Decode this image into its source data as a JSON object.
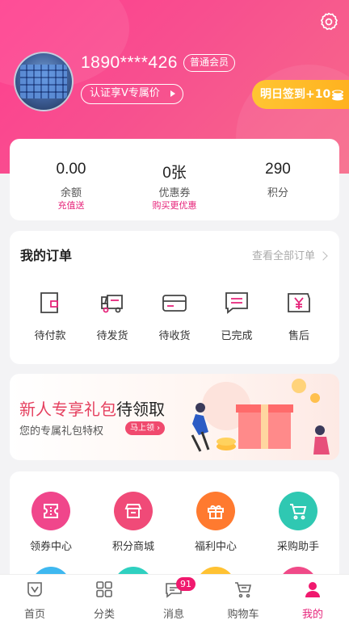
{
  "profile": {
    "phone": "1890****426",
    "member_level": "普通会员",
    "verify_label": "认证享V专属价",
    "sign_in_label": "明日签到+10"
  },
  "stats": [
    {
      "value": "0.00",
      "label": "余额",
      "action": "充值送"
    },
    {
      "value": "0张",
      "label": "优惠券",
      "action": "购买更优惠"
    },
    {
      "value": "290",
      "label": "积分",
      "action": ""
    }
  ],
  "orders": {
    "title": "我的订单",
    "view_all": "查看全部订单",
    "items": [
      {
        "label": "待付款",
        "icon": "wallet-icon"
      },
      {
        "label": "待发货",
        "icon": "delivery-truck-icon"
      },
      {
        "label": "待收货",
        "icon": "card-box-icon"
      },
      {
        "label": "已完成",
        "icon": "message-done-icon"
      },
      {
        "label": "售后",
        "icon": "yen-ticket-icon"
      }
    ]
  },
  "banner": {
    "title_highlight": "新人专享礼包",
    "title_rest": "待领取",
    "subtitle": "您的专属礼包特权",
    "cta": "马上领"
  },
  "services": [
    {
      "label": "领券中心",
      "icon": "coupon-icon",
      "color": "#f0468b"
    },
    {
      "label": "积分商城",
      "icon": "shop-icon",
      "color": "#f04a78"
    },
    {
      "label": "福利中心",
      "icon": "gift-icon",
      "color": "#ff7a2f"
    },
    {
      "label": "采购助手",
      "icon": "cart-icon",
      "color": "#2fc8b2"
    }
  ],
  "tabbar": [
    {
      "label": "首页",
      "icon": "home-icon"
    },
    {
      "label": "分类",
      "icon": "category-icon"
    },
    {
      "label": "消息",
      "icon": "message-icon",
      "badge": "91"
    },
    {
      "label": "购物车",
      "icon": "cart-icon"
    },
    {
      "label": "我的",
      "icon": "profile-icon",
      "active": true
    }
  ],
  "colors": {
    "brand": "#f2478a",
    "accent": "#e6247a",
    "sign_btn": "#ffbd2a"
  }
}
